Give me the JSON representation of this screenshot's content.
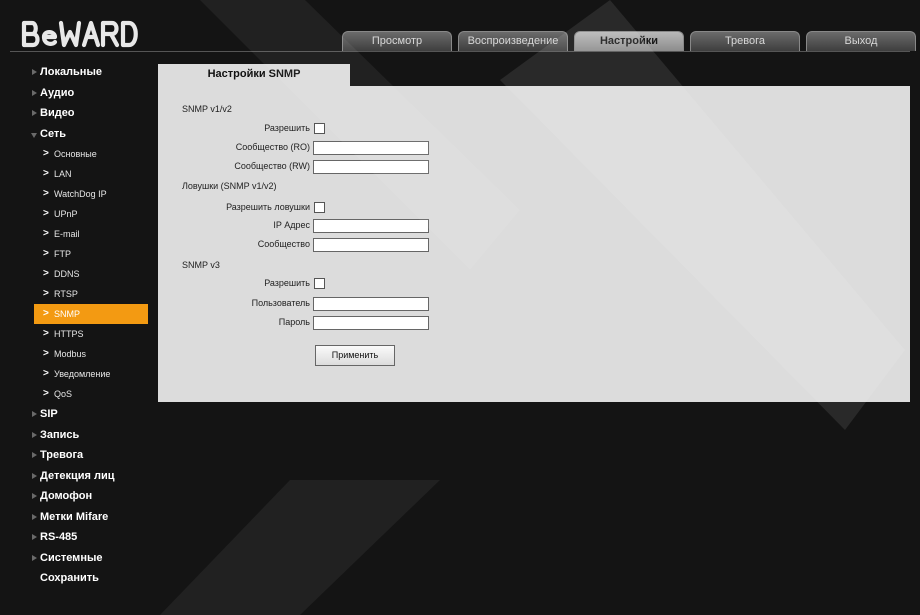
{
  "brand": {
    "logo_text": "BEWARD"
  },
  "tabs": [
    {
      "label": "Просмотр",
      "active": false
    },
    {
      "label": "Воспроизведение",
      "active": false
    },
    {
      "label": "Настройки",
      "active": true
    },
    {
      "label": "Тревога",
      "active": false
    },
    {
      "label": "Выход",
      "active": false
    }
  ],
  "sidebar": {
    "top": [
      {
        "label": "Локальные"
      },
      {
        "label": "Аудио"
      },
      {
        "label": "Видео"
      },
      {
        "label": "Сеть"
      }
    ],
    "network_sub": [
      {
        "label": "Основные"
      },
      {
        "label": "LAN"
      },
      {
        "label": "WatchDog IP"
      },
      {
        "label": "UPnP"
      },
      {
        "label": "E-mail"
      },
      {
        "label": "FTP"
      },
      {
        "label": "DDNS"
      },
      {
        "label": "RTSP"
      },
      {
        "label": "SNMP"
      },
      {
        "label": "HTTPS"
      },
      {
        "label": "Modbus"
      },
      {
        "label": "Уведомление"
      },
      {
        "label": "QoS"
      }
    ],
    "bottom": [
      {
        "label": "SIP"
      },
      {
        "label": "Запись"
      },
      {
        "label": "Тревога"
      },
      {
        "label": "Детекция лиц"
      },
      {
        "label": "Домофон"
      },
      {
        "label": "Метки Mifare"
      },
      {
        "label": "RS-485"
      },
      {
        "label": "Системные"
      },
      {
        "label": "Сохранить"
      }
    ]
  },
  "panel": {
    "title": "Настройки SNMP",
    "v1v2": {
      "heading": "SNMP v1/v2",
      "enable_label": "Разрешить",
      "community_ro_label": "Сообщество (RO)",
      "community_ro_value": "",
      "community_rw_label": "Сообщество (RW)",
      "community_rw_value": ""
    },
    "traps": {
      "heading": "Ловушки (SNMP v1/v2)",
      "enable_label": "Разрешить ловушки",
      "ip_label": "IP Адрес",
      "ip_value": "",
      "community_label": "Сообщество",
      "community_value": ""
    },
    "v3": {
      "heading": "SNMP v3",
      "enable_label": "Разрешить",
      "user_label": "Пользователь",
      "user_value": "",
      "password_label": "Пароль",
      "password_value": ""
    },
    "apply_label": "Применить"
  },
  "colors": {
    "accent": "#f39a12",
    "background": "#141414",
    "panel": "#dcdcdc"
  }
}
